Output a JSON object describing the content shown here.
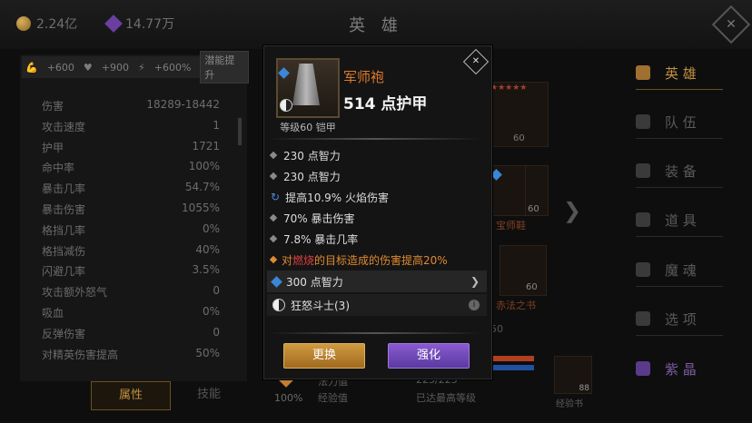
{
  "top_bar": {
    "gold": "2.24亿",
    "gems": "14.77万",
    "title": "英 雄"
  },
  "left_panel": {
    "bonuses": [
      "+600",
      "+900",
      "+600%"
    ],
    "bonus_button": "潜能提升",
    "stats": [
      {
        "label": "伤害",
        "value": "18289-18442"
      },
      {
        "label": "攻击速度",
        "value": "1"
      },
      {
        "label": "护甲",
        "value": "1721"
      },
      {
        "label": "命中率",
        "value": "100%"
      },
      {
        "label": "暴击几率",
        "value": "54.7%"
      },
      {
        "label": "暴击伤害",
        "value": "1055%"
      },
      {
        "label": "格挡几率",
        "value": "0%"
      },
      {
        "label": "格挡减伤",
        "value": "40%"
      },
      {
        "label": "闪避几率",
        "value": "3.5%"
      },
      {
        "label": "攻击额外怒气",
        "value": "0"
      },
      {
        "label": "吸血",
        "value": "0%"
      },
      {
        "label": "反弹伤害",
        "value": "0"
      },
      {
        "label": "对精英伤害提高",
        "value": "50%"
      }
    ],
    "tab_attributes": "属性",
    "tab_skills": "技能"
  },
  "nav": [
    {
      "label": "英 雄",
      "icon": "hero-icon"
    },
    {
      "label": "队 伍",
      "icon": "flag-icon"
    },
    {
      "label": "装 备",
      "icon": "helmet-icon"
    },
    {
      "label": "道 具",
      "icon": "bag-icon"
    },
    {
      "label": "魔 魂",
      "icon": "flame-icon"
    },
    {
      "label": "选 项",
      "icon": "gear-icon"
    },
    {
      "label": "紫 晶",
      "icon": "crystal-icon"
    }
  ],
  "background": {
    "slot_level_1": "60",
    "slot_level_2": "60",
    "slot_level_3": "60",
    "slot_level_4": "60",
    "slot_name_boots": "宝师鞋",
    "slot_name_book": "赤法之书",
    "partial_number": "50",
    "bottom_percent": "100%",
    "row_mana_label": "法力值",
    "row_mana_value": "225/225",
    "row_exp_label": "经验值",
    "row_exp_value": "已达最高等级",
    "book_count": "88",
    "book_label": "经验书"
  },
  "item": {
    "name": "军师袍",
    "armor": "514 点护甲",
    "level": "等级60 铠甲",
    "lines": [
      {
        "icon": "dot",
        "text": "230 点智力"
      },
      {
        "icon": "dot",
        "text": "230 点智力"
      },
      {
        "icon": "refresh-icon",
        "text": "提高10.9% 火焰伤害"
      },
      {
        "icon": "dot",
        "text": "70% 暴击伤害"
      },
      {
        "icon": "dot",
        "text": "7.8% 暴击几率"
      }
    ],
    "special": {
      "prefix": "对",
      "highlight": "燃烧",
      "suffix": "的目标造成的伤害提高20%"
    },
    "socket": "300 点智力",
    "set_name": "狂怒斗士(3)",
    "btn_replace": "更换",
    "btn_enhance": "强化"
  },
  "colors": {
    "item_name": "#e07a2a",
    "special": "#e08a30",
    "burn": "#e04040",
    "btn_replace": "#c08a30",
    "btn_enhance": "#7a4ac0"
  }
}
